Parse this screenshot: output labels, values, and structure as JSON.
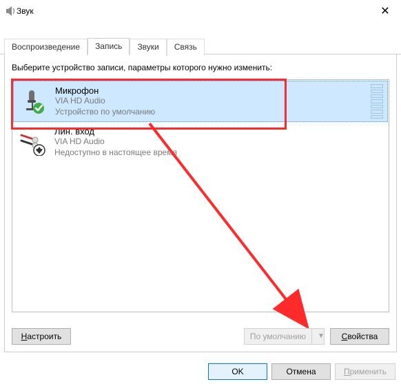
{
  "window": {
    "title": "Звук",
    "close": "✕"
  },
  "tabs": {
    "playback": "Воспроизведение",
    "recording": "Запись",
    "sounds": "Звуки",
    "comm": "Связь"
  },
  "instruction": "Выберите устройство записи, параметры которого нужно изменить:",
  "devices": [
    {
      "name": "Микрофон",
      "driver": "VIA HD Audio",
      "status": "Устройство по умолчанию"
    },
    {
      "name": "Лин. вход",
      "driver": "VIA HD Audio",
      "status": "Недоступно в настоящее время"
    }
  ],
  "buttons": {
    "configure": "Настроить",
    "default": "По умолчанию",
    "properties": "Свойства",
    "ok": "OK",
    "cancel": "Отмена",
    "apply": "Применить"
  }
}
